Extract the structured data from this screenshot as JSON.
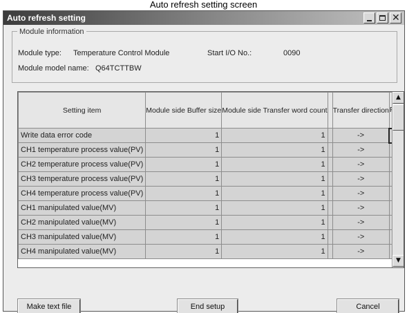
{
  "caption": "Auto refresh setting screen",
  "window": {
    "title": "Auto refresh setting",
    "controls": [
      "minimize-icon",
      "maximize-icon",
      "close-icon"
    ],
    "close_glyph": "✕"
  },
  "module_info": {
    "legend": "Module information",
    "type_label": "Module type:",
    "type_value": "Temperature Control Module",
    "start_io_label": "Start I/O No.:",
    "start_io_value": "0090",
    "model_label": "Module model name:",
    "model_value": "Q64TCTTBW"
  },
  "grid": {
    "headers": [
      "Setting item",
      "Module side Buffer size",
      "Module side Transfer word count",
      "",
      "Transfer direction",
      "PLC side Device"
    ],
    "rows": [
      {
        "item": "Write data error code",
        "buffer": "1",
        "count": "1",
        "blank": "",
        "dir": "->",
        "device": ""
      },
      {
        "item": "CH1 temperature process value(PV)",
        "buffer": "1",
        "count": "1",
        "blank": "",
        "dir": "->",
        "device": ""
      },
      {
        "item": "CH2 temperature process value(PV)",
        "buffer": "1",
        "count": "1",
        "blank": "",
        "dir": "->",
        "device": ""
      },
      {
        "item": "CH3 temperature process value(PV)",
        "buffer": "1",
        "count": "1",
        "blank": "",
        "dir": "->",
        "device": ""
      },
      {
        "item": "CH4 temperature process value(PV)",
        "buffer": "1",
        "count": "1",
        "blank": "",
        "dir": "->",
        "device": ""
      },
      {
        "item": "CH1 manipulated value(MV)",
        "buffer": "1",
        "count": "1",
        "blank": "",
        "dir": "->",
        "device": ""
      },
      {
        "item": "CH2 manipulated value(MV)",
        "buffer": "1",
        "count": "1",
        "blank": "",
        "dir": "->",
        "device": ""
      },
      {
        "item": "CH3 manipulated value(MV)",
        "buffer": "1",
        "count": "1",
        "blank": "",
        "dir": "->",
        "device": ""
      },
      {
        "item": "CH4 manipulated value(MV)",
        "buffer": "1",
        "count": "1",
        "blank": "",
        "dir": "->",
        "device": ""
      }
    ],
    "scroll_up_glyph": "▲",
    "scroll_down_glyph": "▼"
  },
  "buttons": {
    "make_text": "Make text file",
    "end_setup": "End setup",
    "cancel": "Cancel"
  },
  "colors": {
    "titlebar_dark": "#3c3c3c",
    "titlebar_light": "#c4c4c4",
    "dialog_bg": "#ececec",
    "cell_bg": "#d4d4d4",
    "input_bg": "#ffffff"
  }
}
